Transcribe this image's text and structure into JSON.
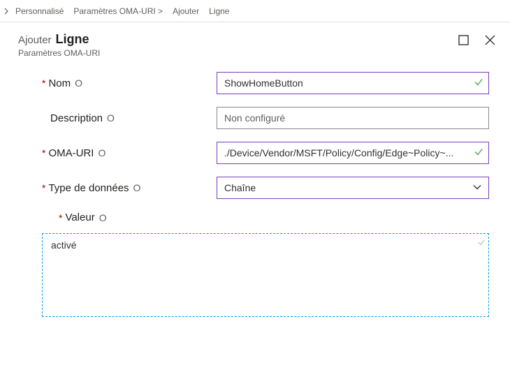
{
  "breadcrumb": {
    "item1": "Personnalisé",
    "item2": "Paramètres OMA-URI >",
    "item3": "Ajouter",
    "item4": "Ligne"
  },
  "panel": {
    "action": "Ajouter",
    "title": "Ligne",
    "subtitle": "Paramètres OMA-URI"
  },
  "labels": {
    "name": "Nom",
    "description": "Description",
    "omauri": "OMA-URI",
    "datatype": "Type de données",
    "value": "Valeur",
    "info": "O"
  },
  "fields": {
    "name": "ShowHomeButton",
    "description": "",
    "description_placeholder": "Non configuré",
    "omauri": "./Device/Vendor/MSFT/Policy/Config/Edge~Policy~...",
    "datatype": "Chaîne",
    "value": "activé"
  }
}
